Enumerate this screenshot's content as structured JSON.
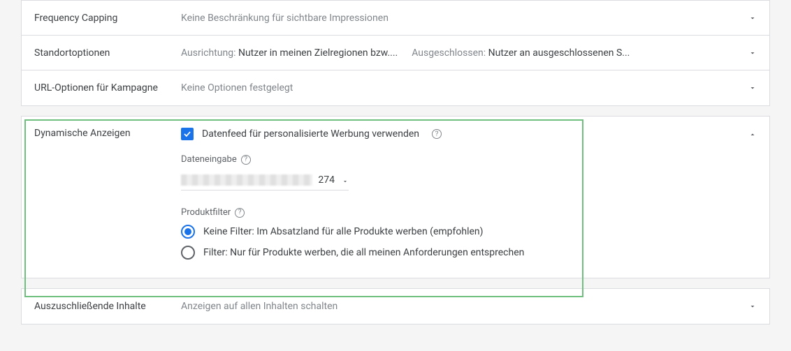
{
  "rows": {
    "frequency_capping": {
      "label": "Frequency Capping",
      "value": "Keine Beschränkung für sichtbare Impressionen"
    },
    "location_options": {
      "label": "Standortoptionen",
      "targeting_key": "Ausrichtung:",
      "targeting_val": "Nutzer in meinen Zielregionen bzw....",
      "excluded_key": "Ausgeschlossen:",
      "excluded_val": "Nutzer an ausgeschlossenen S..."
    },
    "url_options": {
      "label": "URL-Optionen für Kampagne",
      "value": "Keine Optionen festgelegt"
    },
    "dynamic_ads": {
      "label": "Dynamische Anzeigen",
      "checkbox_label": "Datenfeed für personalisierte Werbung verwenden",
      "data_input_label": "Dateneingabe",
      "select_suffix": "274",
      "product_filter_label": "Produktfilter",
      "radio_no_filter": "Keine Filter: Im Absatzland für alle Produkte werben (empfohlen)",
      "radio_filter": "Filter: Nur für Produkte werben, die all meinen Anforderungen entsprechen"
    },
    "excluded_content": {
      "label": "Auszuschließende Inhalte",
      "value": "Anzeigen auf allen Inhalten schalten"
    }
  },
  "icons": {
    "help": "?"
  }
}
